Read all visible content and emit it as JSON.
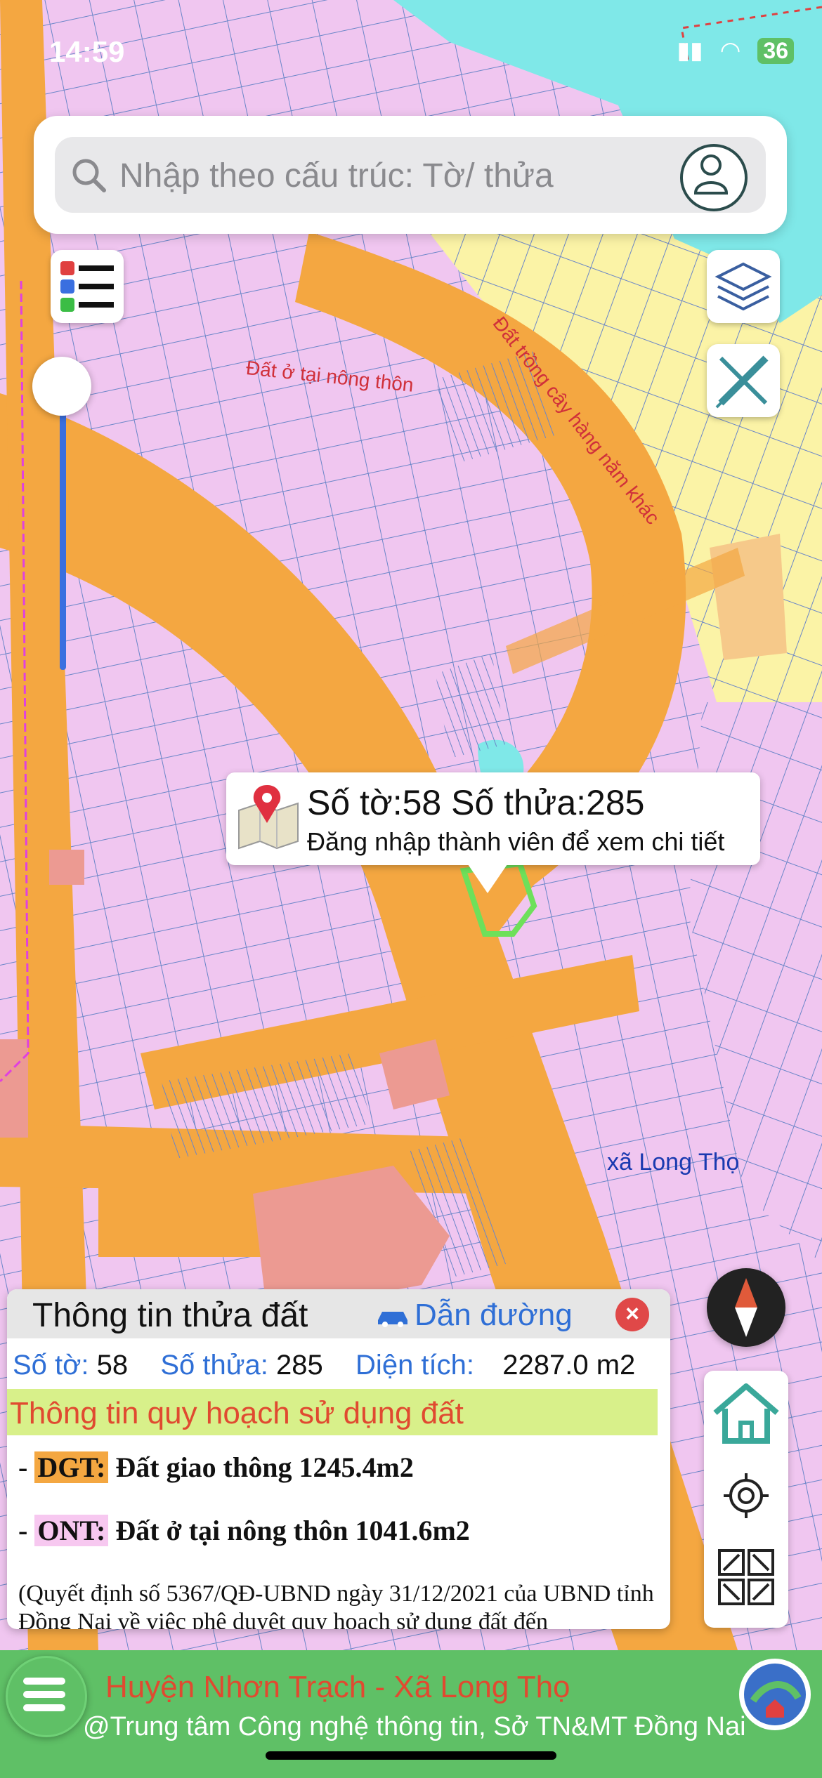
{
  "status_bar": {
    "time": "14:59",
    "battery": "36"
  },
  "search": {
    "placeholder": "Nhập theo cấu trúc: Tờ/ thửa"
  },
  "icons": {
    "search": "search-icon",
    "user": "user-icon",
    "legend": "legend-icon",
    "layers": "layers-icon",
    "measure": "ruler-pencil-icon",
    "compass": "compass-icon",
    "home": "home-icon",
    "locate": "crosshair-icon",
    "qr": "qr-code-icon",
    "car": "car-icon",
    "close": "close-icon",
    "menu": "menu-icon",
    "map_pin": "map-pin-icon"
  },
  "map_labels": {
    "rural_land": "Đất ở tại nông thôn",
    "annual_crops": "Đất trồng cây hàng năm khác",
    "commune": "xã Long Thọ"
  },
  "popup": {
    "title": "Số tờ:58 Số thửa:285",
    "subtitle": "Đăng nhập thành viên để xem chi tiết"
  },
  "parcel_panel": {
    "title": "Thông tin thửa đất",
    "route_label": "Dẫn đường",
    "close_glyph": "×",
    "sheet_label": "Số tờ:",
    "sheet_value": "58",
    "parcel_label": "Số thửa:",
    "parcel_value": "285",
    "area_label": "Diện tích:",
    "area_value": "2287.0 m2",
    "planning_title": "Thông tin quy hoạch sử dụng đất",
    "land_uses": [
      {
        "prefix": "- ",
        "code": "DGT:",
        "desc": " Đất giao thông 1245.4m2"
      },
      {
        "prefix": "- ",
        "code": "ONT:",
        "desc": " Đất ở tại nông thôn 1041.6m2"
      }
    ],
    "decision_text": "(Quyết định số 5367/QĐ-UBND ngày 31/12/2021 của UBND tỉnh Đồng Nai về việc phê duyệt quy hoạch sử dụng đất đến"
  },
  "footer": {
    "location": "Huyện Nhơn Trạch - Xã Long Thọ",
    "credit": "@Trung tâm Công nghệ thông tin, Sở TN&MT Đồng Nai"
  },
  "colors": {
    "residential": "#f0c6f0",
    "road": "#f4a741",
    "crops": "#fbf3a6",
    "water": "#7fe8e8",
    "footer_green": "#5fc066",
    "accent_blue": "#2f6fd6",
    "accent_red": "#e04a30"
  }
}
